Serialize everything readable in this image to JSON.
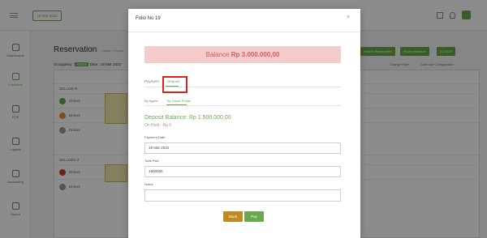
{
  "app": {
    "date_chip": "19 Mar 2022",
    "sidebar": [
      {
        "label": "Dashboards"
      },
      {
        "label": "Frontdesk"
      },
      {
        "label": "POS"
      },
      {
        "label": "Logistic"
      },
      {
        "label": "Accounting"
      },
      {
        "label": "Report"
      }
    ],
    "page_title": "Reservation",
    "breadcrumb": "Home › Fronte",
    "occupancy_label": "Occupancy :",
    "occupancy_badge": "NONE",
    "occupancy_date": "Date : 19 Mar 2022",
    "actions": [
      "Search Reservation",
      "Room Available",
      "ACTION"
    ],
    "change_filter": "Change Filter",
    "calendar_config": "Calendar Configuration",
    "groups": [
      "DELUXE R",
      "DELUXE2 2"
    ],
    "rows": [
      "Deluxe",
      "Deluxe",
      "Deluxe",
      "Deluxe",
      "Deluxe"
    ]
  },
  "modal": {
    "title": "Folio No 19",
    "close_glyph": "×",
    "balance_label": "Balance",
    "balance_amount": "Rp 3.000.000,00",
    "tabs": [
      "Payment",
      "Deposit"
    ],
    "subtabs": [
      "By Agent",
      "By Guest Profile"
    ],
    "deposit_balance": "Deposit Balance: Rp 1.500.000,00",
    "on_hold": "On Hold : Rp 0",
    "fields": {
      "payment_date_label": "Payment Date",
      "payment_date_value": "19 Mar 2022",
      "total_paid_label": "Total Paid",
      "total_paid_value": "1500000",
      "notes_label": "Notes",
      "notes_value": ""
    },
    "buttons": {
      "back": "Back",
      "pay": "Pay"
    }
  },
  "colors": {
    "accent": "#6aa84f",
    "danger_text": "#d65b5b",
    "danger_bg": "#f4cccc",
    "highlight": "#e02020",
    "back_btn": "#c08a1e"
  }
}
